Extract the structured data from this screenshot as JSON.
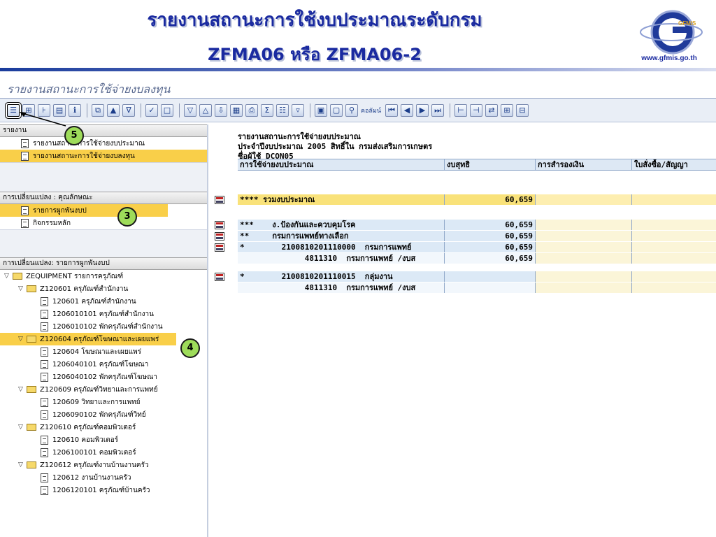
{
  "slide": {
    "title_line1": "รายงานสถานะการใช้งบประมาณระดับกรม",
    "title_line2": "ZFMA06 หรือ ZFMA06-2",
    "logo_text": "GFMIS",
    "logo_url": "www.gfmis.go.th"
  },
  "screen": {
    "title": "รายงานสถานะการใช้จ่ายงบลงทุน"
  },
  "toolbar": {
    "text_button": "คอลัมน์"
  },
  "tree": {
    "section1": {
      "header": "รายงาน",
      "items": [
        "รายงานสถานะการใช้จ่ายงบประมาณ",
        "รายงานสถานะการใช้จ่ายงบลงทุน"
      ]
    },
    "section2": {
      "header": "การเปลี่ยนแปลง : คุณลักษณะ",
      "items": [
        "รายการผูกพันงบป",
        "กิจกรรมหลัก"
      ]
    },
    "section3": {
      "header": "การเปลี่ยนแปลง: รายการผูกพันงบป",
      "nodes": [
        {
          "label": "ZEQUIPMENT รายการครุภัณฑ์",
          "level": 0,
          "type": "folder"
        },
        {
          "label": "Z120601 ครุภัณฑ์สำนักงาน",
          "level": 1,
          "type": "folder"
        },
        {
          "label": "120601 ครุภัณฑ์สำนักงาน",
          "level": 2,
          "type": "doc"
        },
        {
          "label": "1206010101 ครุภัณฑ์สำนักงาน",
          "level": 2,
          "type": "doc"
        },
        {
          "label": "1206010102 พักครุภัณฑ์สำนักงาน",
          "level": 2,
          "type": "doc"
        },
        {
          "label": "Z120604 ครุภัณฑ์โฆษณาและเผยแพร่",
          "level": 1,
          "type": "folder",
          "highlight": true
        },
        {
          "label": "120604 โฆษณาและเผยแพร่",
          "level": 2,
          "type": "doc"
        },
        {
          "label": "1206040101 ครุภัณฑ์โฆษณา",
          "level": 2,
          "type": "doc"
        },
        {
          "label": "1206040102 พักครุภัณฑ์โฆษณา",
          "level": 2,
          "type": "doc"
        },
        {
          "label": "Z120609 ครุภัณฑ์วิทยาและการแพทย์",
          "level": 1,
          "type": "folder"
        },
        {
          "label": "120609 วิทยาและการแพทย์",
          "level": 2,
          "type": "doc"
        },
        {
          "label": "1206090102 พักครุภัณฑ์วิทย์",
          "level": 2,
          "type": "doc"
        },
        {
          "label": "Z120610 ครุภัณฑ์คอมพิวเตอร์",
          "level": 1,
          "type": "folder"
        },
        {
          "label": "120610 คอมพิวเตอร์",
          "level": 2,
          "type": "doc"
        },
        {
          "label": "1206100101 คอมพิวเตอร์",
          "level": 2,
          "type": "doc"
        },
        {
          "label": "Z120612 ครุภัณฑ์งานบ้านงานครัว",
          "level": 1,
          "type": "folder"
        },
        {
          "label": "120612 งานบ้านงานครัว",
          "level": 2,
          "type": "doc"
        },
        {
          "label": "1206120101 ครุภัณฑ์บ้านครัว",
          "level": 2,
          "type": "doc"
        }
      ]
    }
  },
  "report": {
    "heading_lines": [
      "รายงานสถานะการใช้จ่ายงบประมาณ",
      "ประจำปีงบประมาณ 2005 สิทธิ์ใน กรมส่งเสริมการเกษตร",
      "ชื่อผู้ใช้ DCON05"
    ],
    "columns": [
      "การใช้จ่ายงบประมาณ",
      "งบสุทธิ",
      "การสำรองเงิน",
      "ใบสั่งซื้อ/สัญญา"
    ],
    "rows": [
      {
        "label": "**** รวมงบประมาณ",
        "value": "60,659",
        "kind": "total"
      },
      {
        "label": "***    ง.ป้องกันและควบคุมโรค",
        "value": "60,659",
        "kind": "line"
      },
      {
        "label": "**     กรมการแพทย์ทางเลือก",
        "value": "60,659",
        "kind": "line"
      },
      {
        "label": "*        2100810201110000  กรมการแพทย์",
        "value": "60,659",
        "kind": "line"
      },
      {
        "label": "              4811310  กรมการแพทย์ /งบส",
        "value": "60,659",
        "kind": "alt"
      },
      {
        "label": "*        2100810201110015  กลุ่มงาน",
        "value": "",
        "kind": "line"
      },
      {
        "label": "              4811310  กรมการแพทย์ /งบส",
        "value": "",
        "kind": "alt"
      }
    ]
  },
  "callouts": [
    "5",
    "3",
    "4"
  ]
}
